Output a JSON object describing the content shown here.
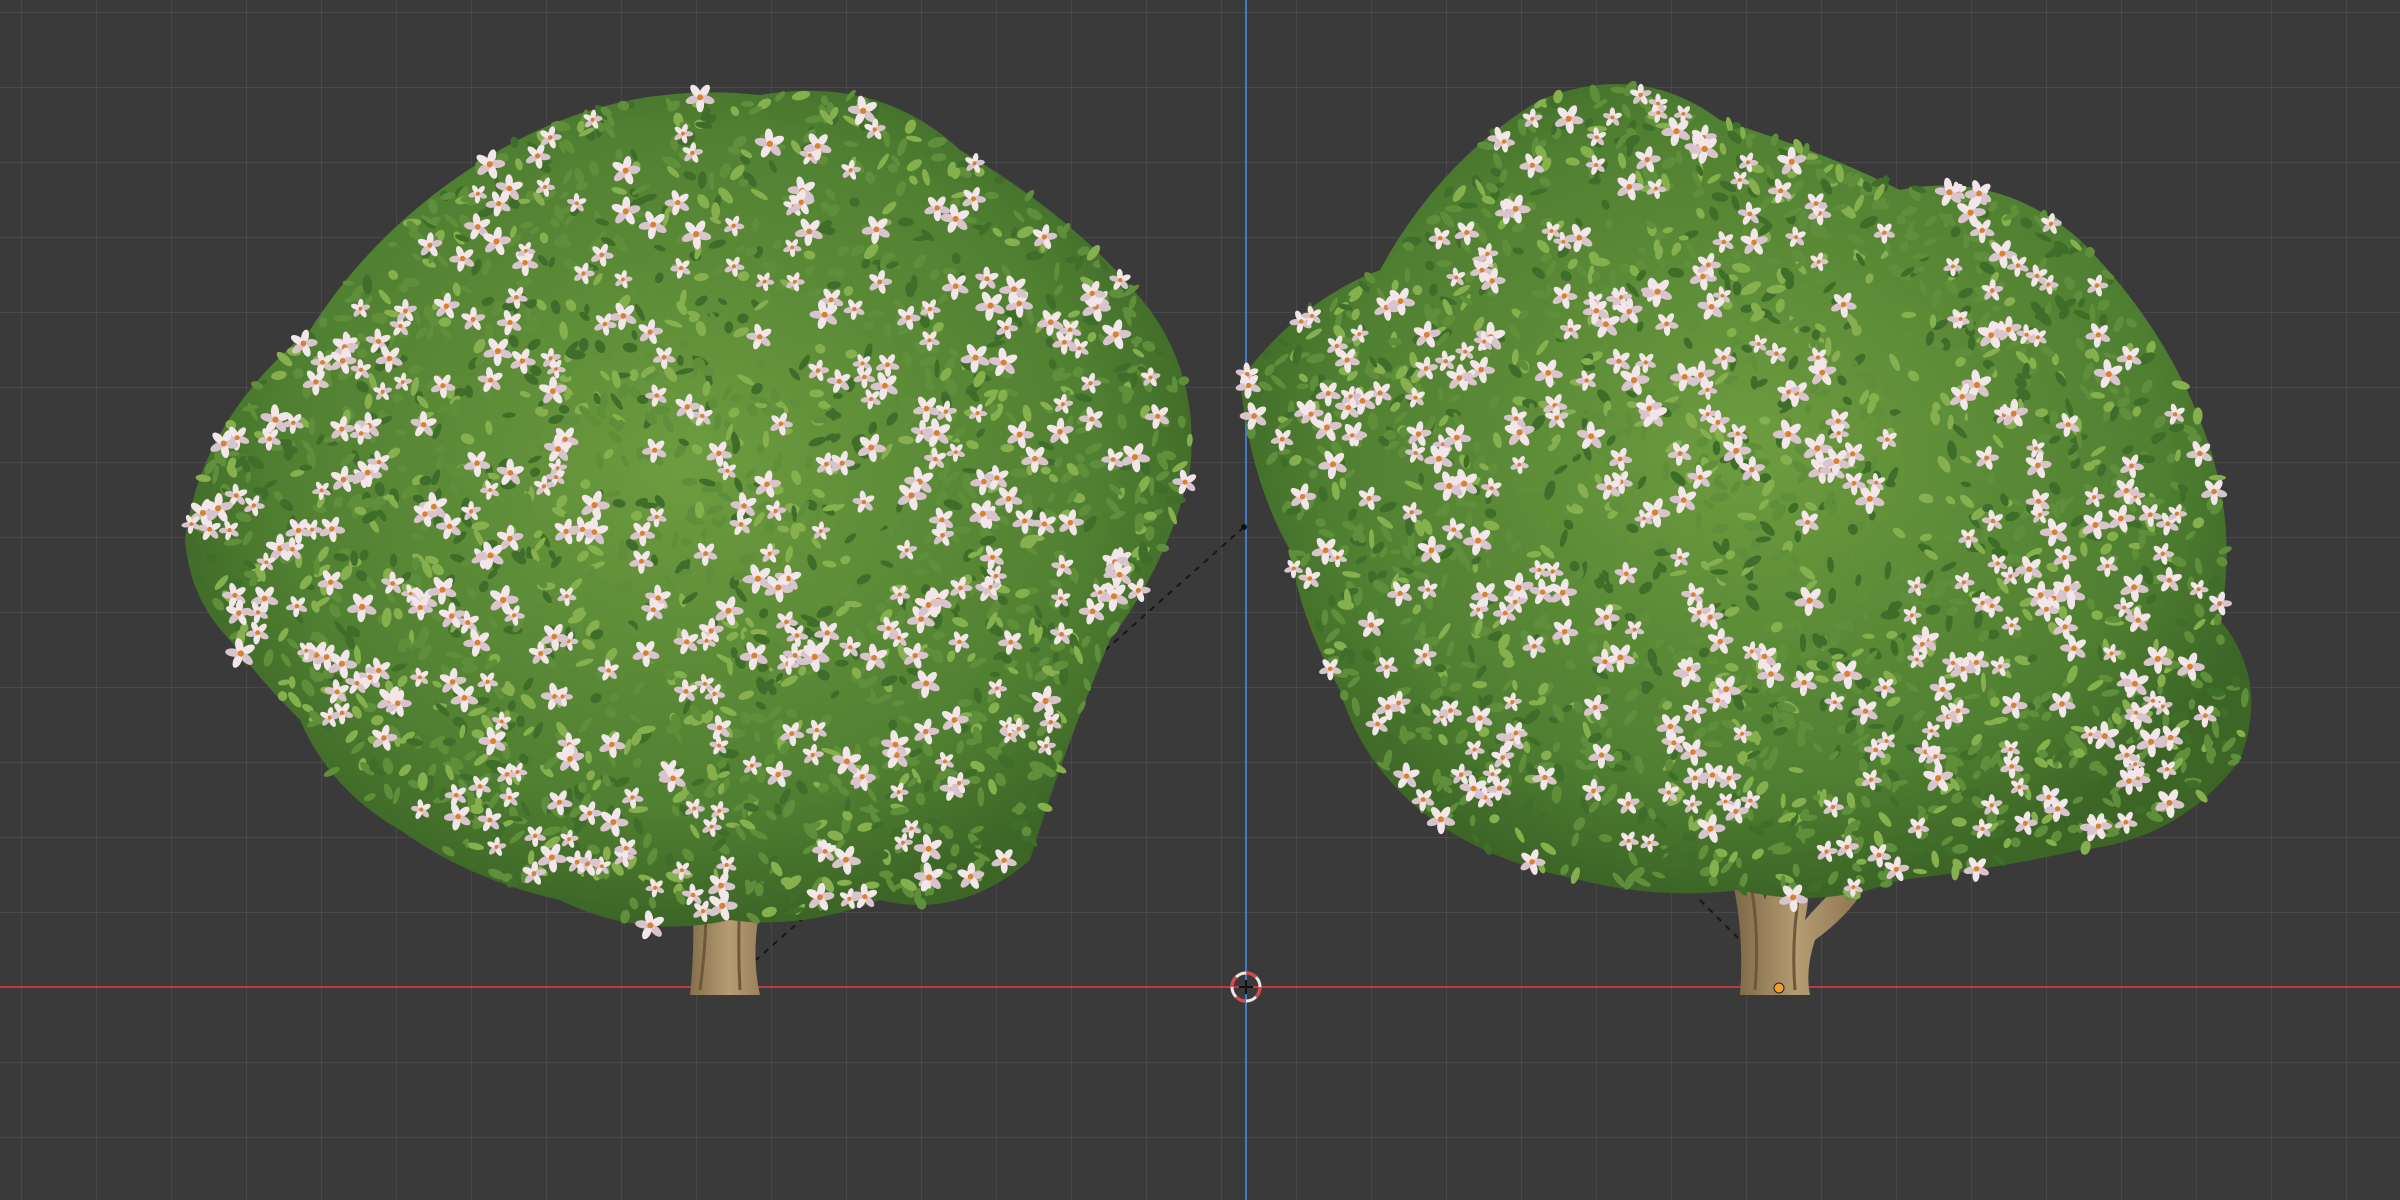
{
  "viewport": {
    "colors": {
      "background": "#3a3a3a",
      "x_axis": "#c0393f",
      "z_axis": "#3f7bc2",
      "origin_ring": "#e9e9e9",
      "origin_accent": "#d8464a",
      "leaf_dark": "#3f6d2a",
      "leaf_mid": "#5f8f3a",
      "leaf_light": "#86b04e",
      "petal": "#f2e6ea",
      "petal_shadow": "#d9c3cc",
      "flower_center": "#d9822b",
      "trunk": "#a48a62",
      "trunk_dark": "#7a6444"
    },
    "objects": [
      "tree-left",
      "tree-right"
    ],
    "active_object": "tree-right"
  }
}
